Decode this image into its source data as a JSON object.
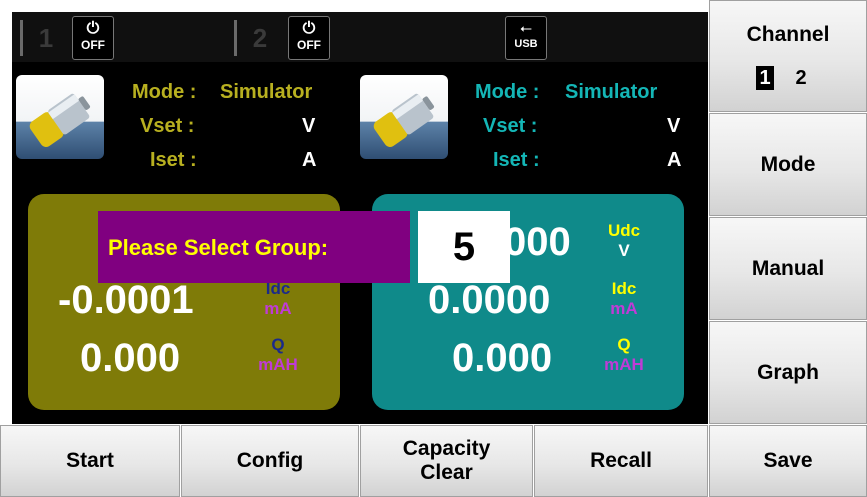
{
  "status_bar": {
    "channel1_number": "1",
    "channel1_power": "OFF",
    "channel2_number": "2",
    "channel2_power": "OFF",
    "usb_label": "USB"
  },
  "channel1": {
    "mode_label": "Mode :",
    "mode_value": "Simulator",
    "vset_label": "Vset :",
    "vset_unit": "V",
    "iset_label": "Iset :",
    "iset_unit": "A",
    "current_value": "-0.0001",
    "idc_label": "Idc",
    "idc_unit": "mA",
    "capacity_value": "0.000",
    "q_label": "Q",
    "q_unit": "mAH"
  },
  "channel2": {
    "mode_label": "Mode :",
    "mode_value": "Simulator",
    "vset_label": "Vset :",
    "vset_unit": "V",
    "iset_label": "Iset :",
    "iset_unit": "A",
    "voltage_value": "000",
    "udc_label": "Udc",
    "udc_unit": "V",
    "current_value": "0.0000",
    "idc_label": "Idc",
    "idc_unit": "mA",
    "capacity_value": "0.000",
    "q_label": "Q",
    "q_unit": "mAH"
  },
  "dialog": {
    "prompt": "Please Select Group:",
    "value": "5"
  },
  "side_menu": {
    "channel_title": "Channel",
    "channel_opt1": "1",
    "channel_opt2": "2",
    "mode": "Mode",
    "manual": "Manual",
    "graph": "Graph"
  },
  "bottom_menu": {
    "start": "Start",
    "config": "Config",
    "capacity_line1": "Capacity",
    "capacity_line2": "Clear",
    "recall": "Recall",
    "save": "Save"
  },
  "colors": {
    "channel1_panel": "#7f7b08",
    "channel2_panel": "#0f8a8a",
    "channel1_text": "#b8b020",
    "channel2_text": "#14b6b6",
    "dialog_bg": "#800080",
    "dialog_text": "#ffff00"
  },
  "icons": [
    "power-icon",
    "usb-icon",
    "battery-icon"
  ]
}
